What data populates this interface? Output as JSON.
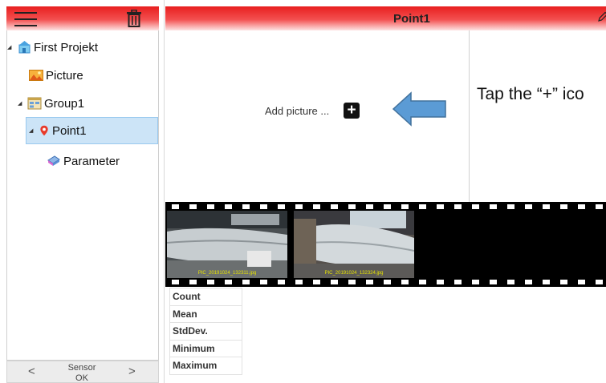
{
  "sidebar": {
    "menu_icon": "hamburger-menu-icon",
    "trash_icon": "trash-icon",
    "tree": [
      {
        "label": "First Projekt",
        "icon": "project-icon",
        "expanded": true
      },
      {
        "label": "Picture",
        "icon": "picture-icon"
      },
      {
        "label": "Group1",
        "icon": "group-icon",
        "expanded": true
      },
      {
        "label": "Point1",
        "icon": "location-pin-icon",
        "expanded": true,
        "selected": true
      },
      {
        "label": "Parameter",
        "icon": "parameter-icon"
      }
    ],
    "footer": {
      "prev": "<",
      "next": ">",
      "sensor_label": "Sensor",
      "sensor_status": "OK"
    }
  },
  "header": {
    "title": "Point1",
    "edit_icon": "pencil-icon"
  },
  "content": {
    "add_picture_label": "Add picture ...",
    "add_button_symbol": "+",
    "instruction": "Tap the “+” ico"
  },
  "filmstrip": {
    "thumbnails": [
      {
        "caption": "PIC_20191024_132311.jpg"
      },
      {
        "caption": "PIC_20191024_132324.jpg"
      }
    ]
  },
  "stats": {
    "rows": [
      "Count",
      "Mean",
      "StdDev.",
      "Minimum",
      "Maximum"
    ]
  },
  "colors": {
    "header_red": "#e81f1f",
    "selection_blue": "#cce4f7",
    "arrow_blue": "#5b9bd5",
    "caption_yellow": "#e6e200"
  }
}
